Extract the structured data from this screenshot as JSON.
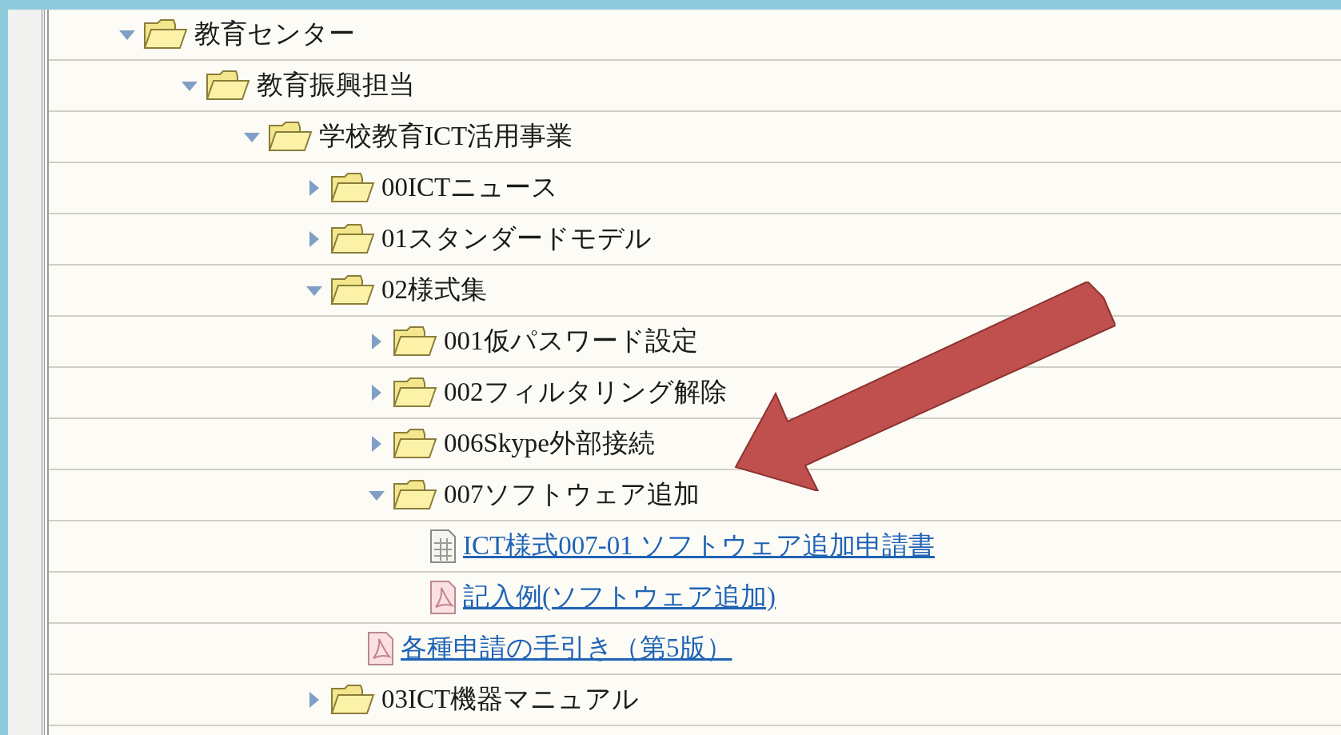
{
  "tree": [
    {
      "label": "教育センター",
      "kind": "folder",
      "expanded": true,
      "children": [
        {
          "label": "教育振興担当",
          "kind": "folder",
          "expanded": true,
          "children": [
            {
              "label": "学校教育ICT活用事業",
              "kind": "folder",
              "expanded": true,
              "children": [
                {
                  "label": "00ICTニュース",
                  "kind": "folder",
                  "expanded": false
                },
                {
                  "label": "01スタンダードモデル",
                  "kind": "folder",
                  "expanded": false
                },
                {
                  "label": "02様式集",
                  "kind": "folder",
                  "expanded": true,
                  "children": [
                    {
                      "label": "001仮パスワード設定",
                      "kind": "folder",
                      "expanded": false
                    },
                    {
                      "label": "002フィルタリング解除",
                      "kind": "folder",
                      "expanded": false
                    },
                    {
                      "label": "006Skype外部接続",
                      "kind": "folder",
                      "expanded": false
                    },
                    {
                      "label": "007ソフトウェア追加",
                      "kind": "folder",
                      "expanded": true,
                      "children": [
                        {
                          "label": "ICT様式007-01 ソフトウェア追加申請書",
                          "kind": "sheet"
                        },
                        {
                          "label": "記入例(ソフトウェア追加)",
                          "kind": "pdf"
                        }
                      ]
                    },
                    {
                      "label": "各種申請の手引き（第5版）",
                      "kind": "pdf"
                    }
                  ]
                },
                {
                  "label": "03ICT機器マニュアル",
                  "kind": "folder",
                  "expanded": false
                }
              ]
            }
          ]
        }
      ]
    }
  ]
}
